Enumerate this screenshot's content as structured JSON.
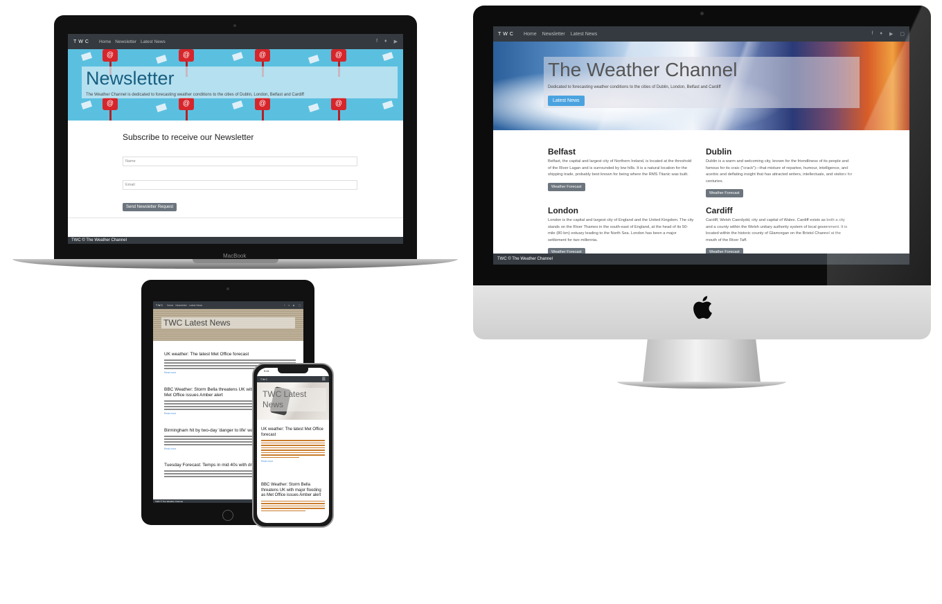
{
  "site": {
    "brand": "TWC",
    "nav_links": [
      "Home",
      "Newsletter",
      "Latest News"
    ],
    "social_icons": [
      "facebook-icon",
      "twitter-icon",
      "youtube-icon",
      "instagram-icon"
    ],
    "footer": "TWC © The Weather Channel"
  },
  "imac": {
    "hero_title": "The Weather Channel",
    "hero_subtitle": "Dedicated to forecasting weather conditions to the cities of Dublin, London, Belfast and Cardiff",
    "hero_button": "Latest News",
    "cities": [
      {
        "name": "Belfast",
        "text": "Belfast, the capital and largest city of Northern Ireland, is located at the threshold of the River Lagan and is surrounded by low hills. It is a natural location for the shipping trade, probably best known for being where the RMS Titanic was built.",
        "button": "Weather Forecast"
      },
      {
        "name": "Dublin",
        "text": "Dublin is a warm and welcoming city, known for the friendliness of its people and famous for its craic (\"crack\")—that mixture of repartee, humour, intelligence, and acerbic and deflating insight that has attracted writers, intellectuals, and visitors for centuries.",
        "button": "Weather Forecast"
      },
      {
        "name": "London",
        "text": "London is the capital and largest city of England and the United Kingdom. The city stands on the River Thames in the south-east of England, at the head of its 50-mile (80 km) estuary leading to the North Sea. London has been a major settlement for two millennia.",
        "button": "Weather Forecast"
      },
      {
        "name": "Cardiff",
        "text": "Cardiff, Welsh Caerdydd, city and capital of Wales. Cardiff exists as both a city and a county within the Welsh unitary authority system of local government. It is located within the historic county of Glamorgan on the Bristol Channel at the mouth of the River Taff.",
        "button": "Weather Forecast"
      }
    ]
  },
  "macbook": {
    "device_label": "MacBook",
    "hero_title": "Newsletter",
    "hero_subtitle": "The Weather Channel is dedicated to forecasting weather conditions to the cities of Dublin, London, Belfast and Cardiff",
    "form_title": "Subscribe to receive our Newsletter",
    "name_placeholder": "Name",
    "email_placeholder": "Email",
    "submit_button": "Send Newsletter Request"
  },
  "ipad": {
    "hero_title": "TWC Latest News",
    "articles": [
      "UK weather: The latest Met Office forecast",
      "BBC Weather: Storm Bella threatens UK with major flooding as Met Office issues Amber alert",
      "Birmingham hit by two-day 'danger to life' warning",
      "Tuesday Forecast: Temps in mid 40s with dry conditions"
    ],
    "read_more": "Read more"
  },
  "iphone": {
    "time": "9:41",
    "hero_title": "TWC Latest News",
    "articles": [
      "UK weather: The latest Met Office forecast",
      "BBC Weather: Storm Bella threatens UK with major flooding as Met Office issues Amber alert"
    ],
    "read_more": "Read more"
  }
}
